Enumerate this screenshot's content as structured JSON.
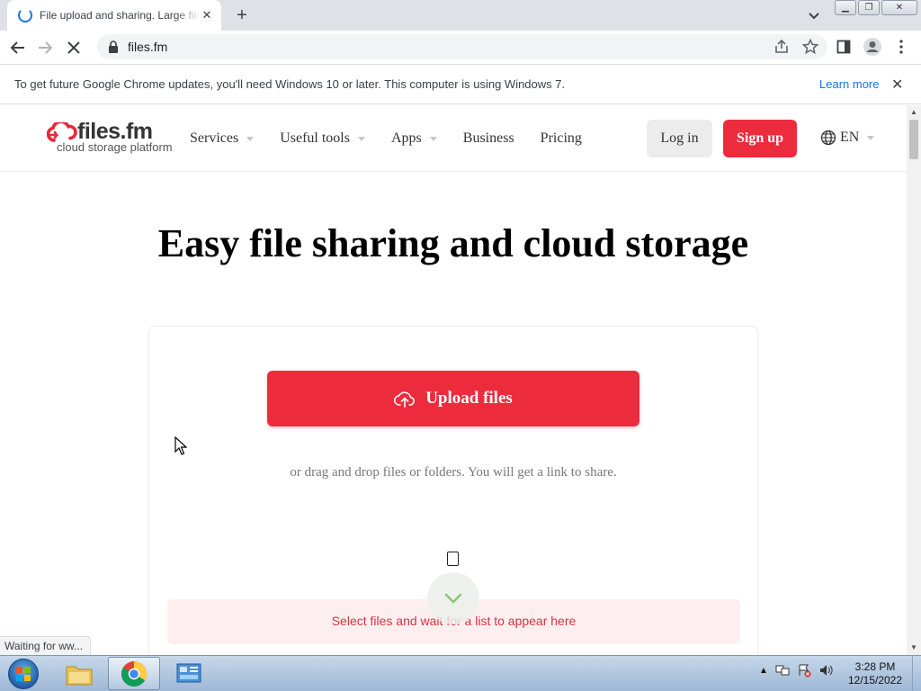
{
  "browser": {
    "tab_title": "File upload and sharing. Large files",
    "url": "files.fm",
    "infobar_text": "To get future Google Chrome updates, you'll need Windows 10 or later. This computer is using Windows 7.",
    "infobar_link": "Learn more",
    "status_text": "Waiting for ww..."
  },
  "site": {
    "logo_main": "files.fm",
    "logo_sub": "cloud storage platform",
    "nav": [
      "Services",
      "Useful tools",
      "Apps",
      "Business",
      "Pricing"
    ],
    "login_label": "Log in",
    "signup_label": "Sign up",
    "language": "EN"
  },
  "hero": {
    "title": "Easy file sharing and cloud storage",
    "upload_label": "Upload files",
    "drag_hint": "or drag and drop files or folders. You will get a link to share.",
    "select_hint": "Select files and wait for a list to appear here"
  },
  "taskbar": {
    "time": "3:28 PM",
    "date": "12/15/2022"
  },
  "colors": {
    "brand_red": "#ec2c3d",
    "hint_bg": "#fdeff0",
    "link_blue": "#1a73e8"
  }
}
